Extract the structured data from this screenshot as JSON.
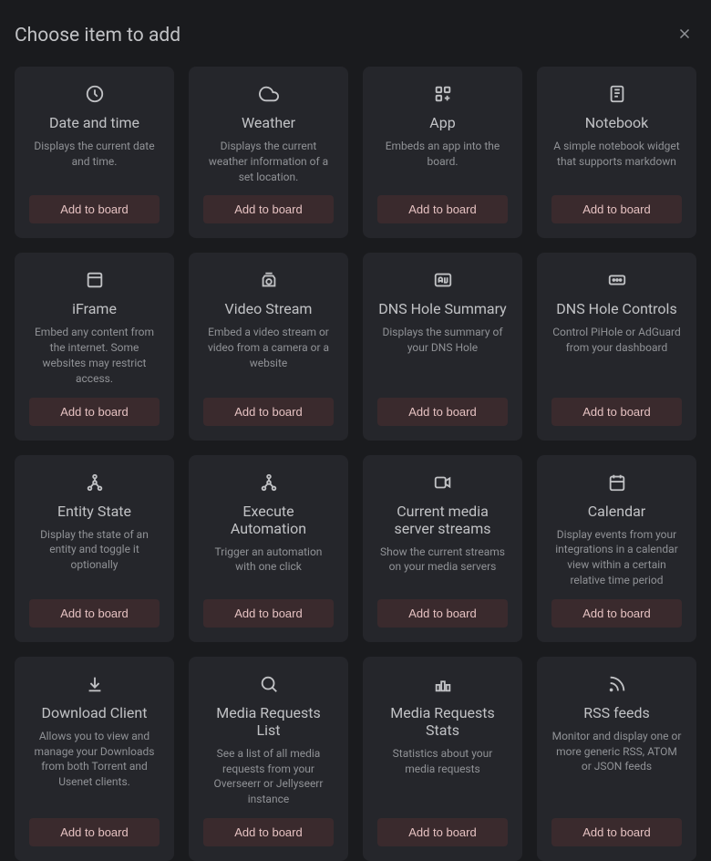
{
  "header": {
    "title": "Choose item to add"
  },
  "button_label": "Add to board",
  "items": [
    {
      "icon": "clock",
      "title": "Date and time",
      "desc": "Displays the current date and time."
    },
    {
      "icon": "cloud",
      "title": "Weather",
      "desc": "Displays the current weather information of a set location."
    },
    {
      "icon": "apps",
      "title": "App",
      "desc": "Embeds an app into the board."
    },
    {
      "icon": "notebook",
      "title": "Notebook",
      "desc": "A simple notebook widget that supports markdown"
    },
    {
      "icon": "iframe",
      "title": "iFrame",
      "desc": "Embed any content from the internet. Some websites may restrict access."
    },
    {
      "icon": "camera",
      "title": "Video Stream",
      "desc": "Embed a video stream or video from a camera or a website"
    },
    {
      "icon": "ad",
      "title": "DNS Hole Summary",
      "desc": "Displays the summary of your DNS Hole"
    },
    {
      "icon": "controls",
      "title": "DNS Hole Controls",
      "desc": "Control PiHole or AdGuard from your dashboard"
    },
    {
      "icon": "tree",
      "title": "Entity State",
      "desc": "Display the state of an entity and toggle it optionally"
    },
    {
      "icon": "tree",
      "title": "Execute Automation",
      "desc": "Trigger an automation with one click"
    },
    {
      "icon": "video",
      "title": "Current media server streams",
      "desc": "Show the current streams on your media servers"
    },
    {
      "icon": "calendar",
      "title": "Calendar",
      "desc": "Display events from your integrations in a calendar view within a certain relative time period"
    },
    {
      "icon": "download",
      "title": "Download Client",
      "desc": "Allows you to view and manage your Downloads from both Torrent and Usenet clients."
    },
    {
      "icon": "search",
      "title": "Media Requests List",
      "desc": "See a list of all media requests from your Overseerr or Jellyseerr instance"
    },
    {
      "icon": "stats",
      "title": "Media Requests Stats",
      "desc": "Statistics about your media requests"
    },
    {
      "icon": "rss",
      "title": "RSS feeds",
      "desc": "Monitor and display one or more generic RSS, ATOM or JSON feeds"
    }
  ]
}
